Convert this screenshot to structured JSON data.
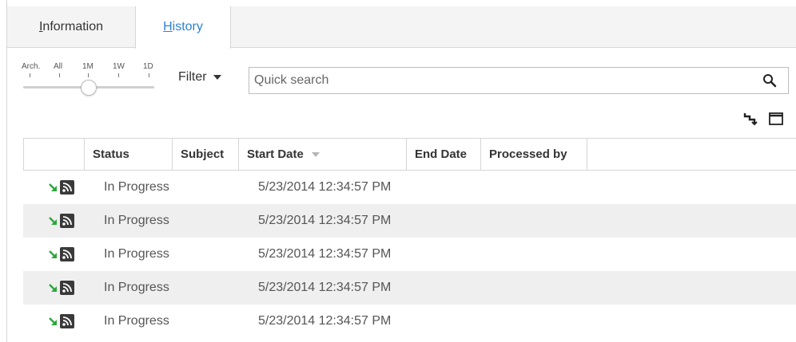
{
  "tabs": [
    {
      "label": "Information",
      "accel": "I",
      "rest": "nformation"
    },
    {
      "label": "History",
      "accel": "H",
      "rest": "istory"
    }
  ],
  "slider": {
    "labels": [
      "Arch.",
      "All",
      "1M",
      "1W",
      "1D"
    ],
    "selected": "1M"
  },
  "filter": {
    "label": "Filter"
  },
  "search": {
    "placeholder": "Quick search"
  },
  "toolbar": {
    "icons": [
      "expand-icon",
      "window-icon"
    ]
  },
  "grid": {
    "columns": [
      "Status",
      "Subject",
      "Start Date",
      "End Date",
      "Processed by"
    ],
    "sorted_column": "Start Date",
    "rows": [
      {
        "status": "In Progress",
        "subject": "",
        "start_date": "5/23/2014 12:34:57 PM",
        "end_date": "",
        "processed_by": ""
      },
      {
        "status": "In Progress",
        "subject": "",
        "start_date": "5/23/2014 12:34:57 PM",
        "end_date": "",
        "processed_by": ""
      },
      {
        "status": "In Progress",
        "subject": "",
        "start_date": "5/23/2014 12:34:57 PM",
        "end_date": "",
        "processed_by": ""
      },
      {
        "status": "In Progress",
        "subject": "",
        "start_date": "5/23/2014 12:34:57 PM",
        "end_date": "",
        "processed_by": ""
      },
      {
        "status": "In Progress",
        "subject": "",
        "start_date": "5/23/2014 12:34:57 PM",
        "end_date": "",
        "processed_by": ""
      }
    ]
  },
  "colors": {
    "active_tab": "#2e82d6",
    "arrow_green": "#2aa83a",
    "alt_row": "#efefef",
    "border": "#d6d6d6"
  }
}
